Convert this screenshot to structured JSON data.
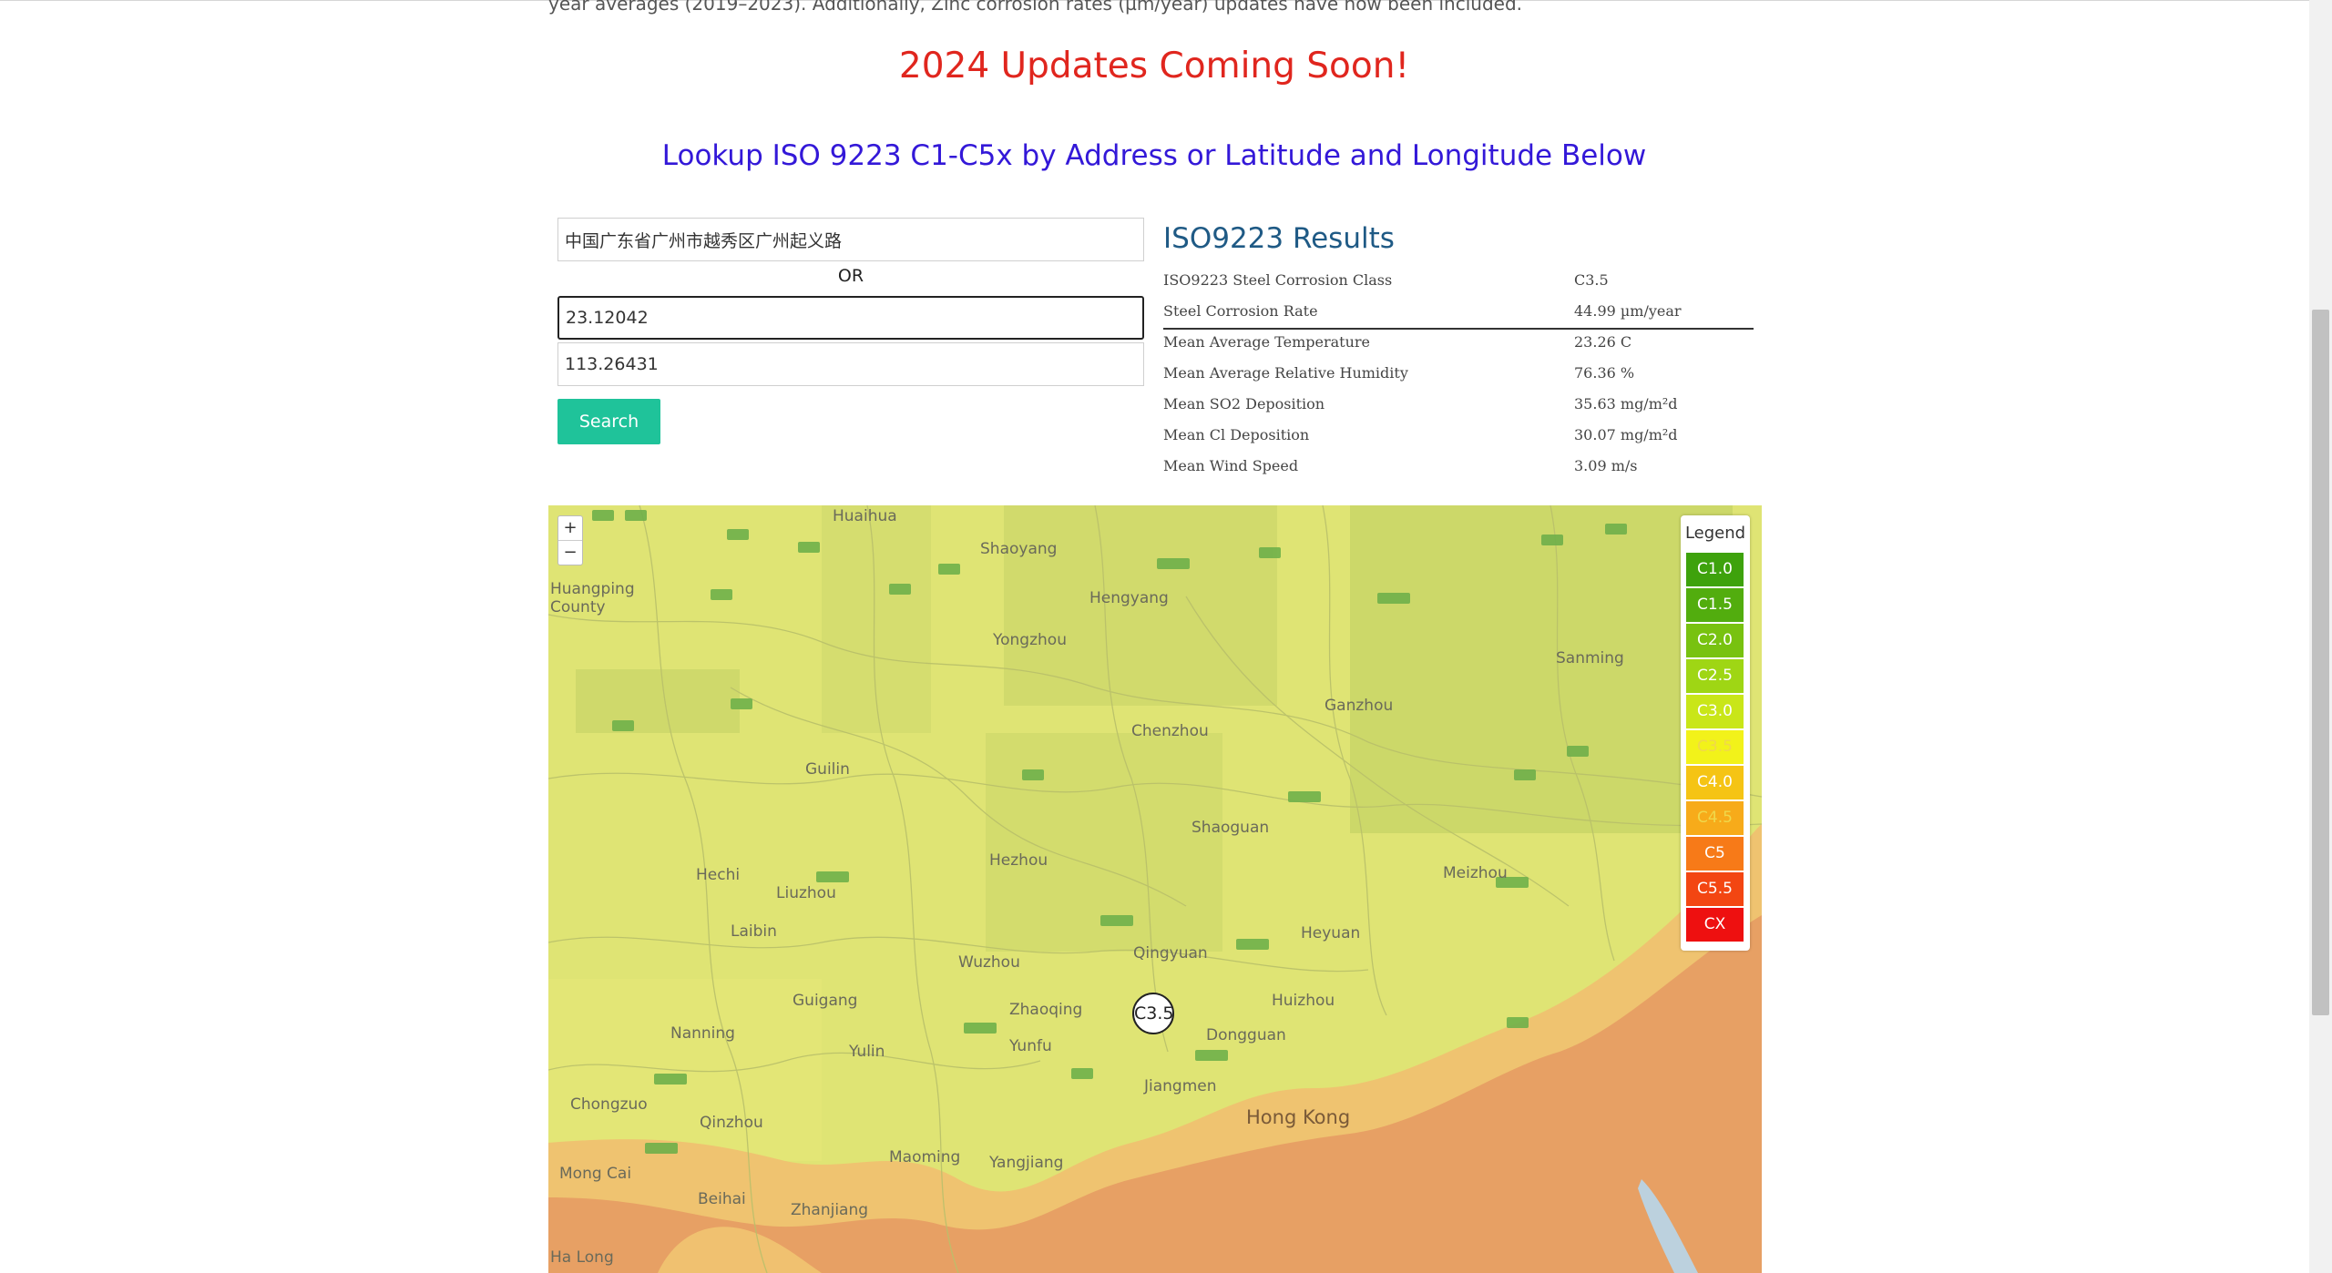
{
  "intro_text": "year averages (2019–2023). Additionally, Zinc corrosion rates (µm/year) updates have now been included.",
  "announcement": "2024 Updates Coming Soon!",
  "lookup_heading": "Lookup ISO 9223 C1-C5x by Address or Latitude and Longitude Below",
  "form": {
    "address_value": "中国广东省广州市越秀区广州起义路",
    "or_label": "OR",
    "latitude_value": "23.12042",
    "longitude_value": "113.26431",
    "search_label": "Search"
  },
  "results": {
    "title": "ISO9223 Results",
    "rows": [
      {
        "label": "ISO9223 Steel Corrosion Class",
        "value": "C3.5"
      },
      {
        "label": "Steel Corrosion Rate",
        "value": "44.99 µm/year"
      },
      {
        "label": "Mean Average Temperature",
        "value": "23.26 C"
      },
      {
        "label": "Mean Average Relative Humidity",
        "value": "76.36 %"
      },
      {
        "label": "Mean SO2 Deposition",
        "value": "35.63 mg/m²d"
      },
      {
        "label": "Mean Cl Deposition",
        "value": "30.07 mg/m²d"
      },
      {
        "label": "Mean Wind Speed",
        "value": "3.09 m/s"
      }
    ]
  },
  "map": {
    "zoom_in": "+",
    "zoom_out": "−",
    "marker_label": "C3.5",
    "legend": {
      "title": "Legend",
      "items": [
        {
          "label": "C1.0",
          "color": "#3ea20c"
        },
        {
          "label": "C1.5",
          "color": "#52ad0e"
        },
        {
          "label": "C2.0",
          "color": "#78c210"
        },
        {
          "label": "C2.5",
          "color": "#9fd614"
        },
        {
          "label": "C3.0",
          "color": "#c9e618"
        },
        {
          "label": "C3.5",
          "color": "#f2f21a"
        },
        {
          "label": "C4.0",
          "color": "#f5c414"
        },
        {
          "label": "C4.5",
          "color": "#f7ab1a"
        },
        {
          "label": "C5",
          "color": "#f77a18"
        },
        {
          "label": "C5.5",
          "color": "#f34612"
        },
        {
          "label": "CX",
          "color": "#ee1010"
        }
      ]
    },
    "cities": [
      {
        "name": "Huaihua"
      },
      {
        "name": "Shaoyang"
      },
      {
        "name": "Hengyang"
      },
      {
        "name": "Huangping County"
      },
      {
        "name": "Yongzhou"
      },
      {
        "name": "Sanming"
      },
      {
        "name": "Chenzhou"
      },
      {
        "name": "Ganzhou"
      },
      {
        "name": "Guilin"
      },
      {
        "name": "Shaoguan"
      },
      {
        "name": "Hezhou"
      },
      {
        "name": "Hechi"
      },
      {
        "name": "Liuzhou"
      },
      {
        "name": "Meizhou"
      },
      {
        "name": "Laibin"
      },
      {
        "name": "Heyuan"
      },
      {
        "name": "Qingyuan"
      },
      {
        "name": "Wuzhou"
      },
      {
        "name": "Guigang"
      },
      {
        "name": "Zhaoqing"
      },
      {
        "name": "Huizhou"
      },
      {
        "name": "Nanning"
      },
      {
        "name": "Yulin"
      },
      {
        "name": "Yunfu"
      },
      {
        "name": "Dongguan"
      },
      {
        "name": "Chongzuo"
      },
      {
        "name": "Qinzhou"
      },
      {
        "name": "Jiangmen"
      },
      {
        "name": "Hong Kong"
      },
      {
        "name": "Maoming"
      },
      {
        "name": "Yangjiang"
      },
      {
        "name": "Mong Cai"
      },
      {
        "name": "Beihai"
      },
      {
        "name": "Zhanjiang"
      },
      {
        "name": "Ha Long"
      }
    ]
  }
}
